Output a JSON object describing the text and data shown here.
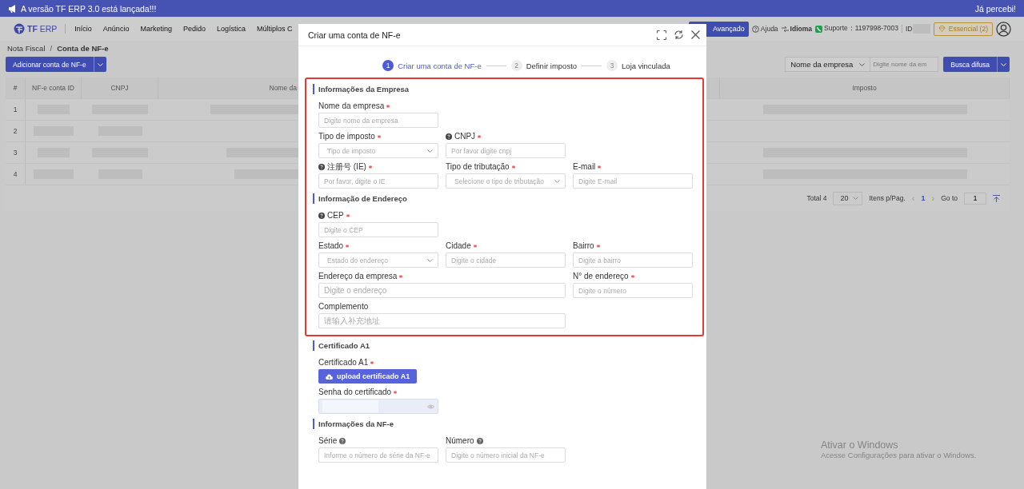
{
  "banner": {
    "message": "A versão TF ERP 3.0 está lançada!!!",
    "dismiss": "Já percebi!"
  },
  "nav": {
    "logo_strong": "TF",
    "logo_light": "ERP",
    "items": [
      "Início",
      "Anúncio",
      "Marketing",
      "Pedido",
      "Logística",
      "Múltiplos C"
    ],
    "upgrade_button": "Avançado",
    "help": "Ajuda",
    "language": "Idioma",
    "support": "Suporte：1197998-7003",
    "id_label": "ID:",
    "plan": "Essencial (2)"
  },
  "breadcrumb": {
    "items": [
      "Nota Fiscal",
      "Conta de NF-e"
    ],
    "separator": "/"
  },
  "add_button": "Adicionar conta de NF-e",
  "search": {
    "field": "Nome da empresa",
    "placeholder": "Digite nome da em",
    "button": "Busca difusa"
  },
  "table": {
    "columns": [
      "#",
      "NF-e conta ID",
      "CNPJ",
      "Nome da",
      "Imposto"
    ],
    "rows": [
      {
        "index": "1"
      },
      {
        "index": "2"
      },
      {
        "index": "3"
      },
      {
        "index": "4"
      }
    ]
  },
  "pagination": {
    "total": "Total 4",
    "page_size": "20",
    "per_page": "Itens p/Pag.",
    "prev": "‹",
    "current": "1",
    "next": "›",
    "goto_label": "Go to",
    "goto_value": "1"
  },
  "modal": {
    "title": "Criar uma conta de NF-e",
    "steps": [
      {
        "number": "1",
        "label": "Criar uma conta de NF-e",
        "selected": true
      },
      {
        "number": "2",
        "label": "Definir imposto",
        "selected": false
      },
      {
        "number": "3",
        "label": "Loja vinculada",
        "selected": false
      }
    ],
    "sections": [
      {
        "title": "Informações da Empresa",
        "highlighted": true,
        "rows": [
          [
            {
              "label": "Nome da empresa",
              "required": true,
              "kind": "input",
              "placeholder": "Digite nome da empresa"
            }
          ],
          [
            {
              "label": "Tipo de imposto",
              "required": true,
              "kind": "select",
              "placeholder": "Tipo de imposto"
            },
            {
              "label": "CNPJ",
              "required": true,
              "help_before": true,
              "kind": "input",
              "placeholder": "Por favor digite cnpj"
            }
          ],
          [
            {
              "label": "注册号 (IE)",
              "required": true,
              "help_before": true,
              "kind": "input",
              "placeholder": "Por favor, digite o IE"
            },
            {
              "label": "Tipo de tributação",
              "required": true,
              "kind": "select",
              "placeholder": "Selecione o tipo de tributação"
            },
            {
              "label": "E-mail",
              "required": true,
              "kind": "input",
              "placeholder": "Digite E-mail"
            }
          ]
        ]
      },
      {
        "title": "Informação de Endereço",
        "highlighted": true,
        "rows": [
          [
            {
              "label": "CEP",
              "required": true,
              "help_before": true,
              "kind": "input",
              "placeholder": "Digite o CEP"
            }
          ],
          [
            {
              "label": "Estado",
              "required": true,
              "kind": "select",
              "placeholder": "Estado do endereço"
            },
            {
              "label": "Cidade",
              "required": true,
              "kind": "input",
              "placeholder": "Digite o cidade"
            },
            {
              "label": "Bairro",
              "required": true,
              "kind": "input",
              "placeholder": "Digite a bairro"
            }
          ],
          [
            {
              "label": "Endereço da empresa",
              "required": true,
              "kind": "input",
              "colspan": 2,
              "placeholder": "Digite o endereço"
            },
            {
              "label": "N° de endereço",
              "required": true,
              "kind": "input",
              "placeholder": "Digite o número"
            }
          ],
          [
            {
              "label": "Complemento",
              "required": false,
              "kind": "input",
              "colspan": 2,
              "placeholder": "请输入补充地址"
            }
          ]
        ]
      },
      {
        "title": "Certificado A1",
        "highlighted": false,
        "rows": [
          [
            {
              "label": "Certificado A1",
              "required": true,
              "kind": "upload",
              "button": "upload certificado A1"
            }
          ],
          [
            {
              "label": "Senha do certificado",
              "required": true,
              "kind": "password"
            }
          ]
        ]
      },
      {
        "title": "Informações da NF-e",
        "highlighted": false,
        "rows": [
          [
            {
              "label": "Série",
              "required": false,
              "help_after": true,
              "kind": "input",
              "placeholder": "Informe o número de série da NF-e"
            },
            {
              "label": "Número",
              "required": false,
              "help_after": true,
              "kind": "input",
              "placeholder": "Digite o número inicial da NF-e"
            }
          ]
        ]
      }
    ]
  },
  "windows_notice": {
    "title": "Ativar o Windows",
    "message": "Acesse Configurações para ativar o Windows."
  }
}
